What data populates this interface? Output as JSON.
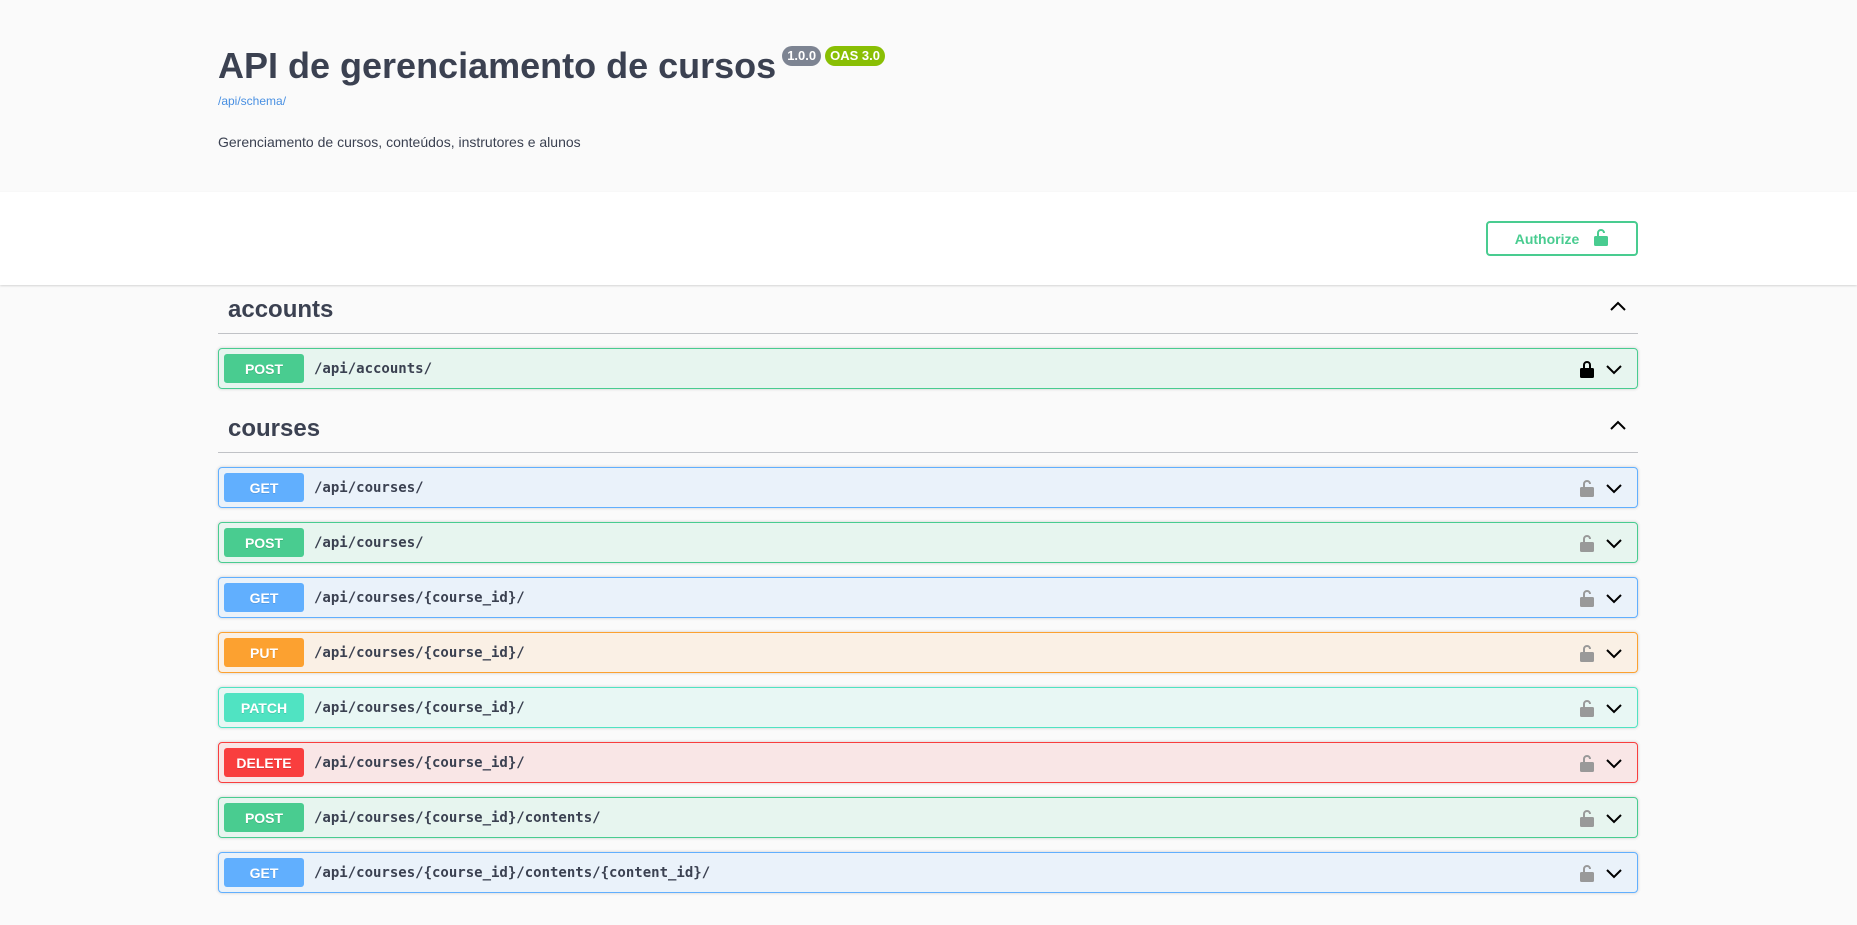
{
  "info": {
    "title": "API de gerenciamento de cursos",
    "version_badge": "1.0.0",
    "oas_badge": "OAS 3.0",
    "schema_link": "/api/schema/",
    "description": "Gerenciamento de cursos, conteúdos, instrutores e alunos"
  },
  "authorize": {
    "label": "Authorize"
  },
  "colors": {
    "post": "#49cc90",
    "get": "#61affe",
    "put": "#fca130",
    "patch": "#50e3c2",
    "delete": "#f93e3e"
  },
  "tags": [
    {
      "name": "accounts",
      "operations": [
        {
          "method": "POST",
          "path": "/api/accounts/",
          "locked": true
        }
      ]
    },
    {
      "name": "courses",
      "operations": [
        {
          "method": "GET",
          "path": "/api/courses/",
          "locked": false
        },
        {
          "method": "POST",
          "path": "/api/courses/",
          "locked": false
        },
        {
          "method": "GET",
          "path": "/api/courses/{course_id}/",
          "locked": false
        },
        {
          "method": "PUT",
          "path": "/api/courses/{course_id}/",
          "locked": false
        },
        {
          "method": "PATCH",
          "path": "/api/courses/{course_id}/",
          "locked": false
        },
        {
          "method": "DELETE",
          "path": "/api/courses/{course_id}/",
          "locked": false
        },
        {
          "method": "POST",
          "path": "/api/courses/{course_id}/contents/",
          "locked": false
        },
        {
          "method": "GET",
          "path": "/api/courses/{course_id}/contents/{content_id}/",
          "locked": false
        }
      ]
    }
  ]
}
